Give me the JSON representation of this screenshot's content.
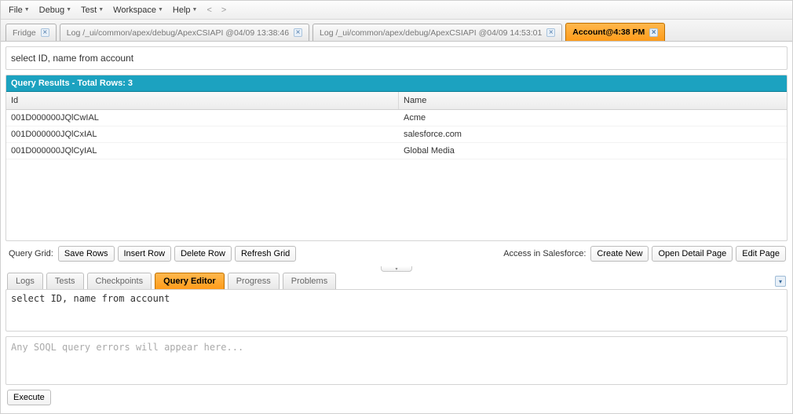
{
  "menubar": {
    "items": [
      "File",
      "Debug",
      "Test",
      "Workspace",
      "Help"
    ]
  },
  "tabs": [
    {
      "label": "Fridge",
      "active": false
    },
    {
      "label": "Log /_ui/common/apex/debug/ApexCSIAPI @04/09 13:38:46",
      "active": false
    },
    {
      "label": "Log /_ui/common/apex/debug/ApexCSIAPI @04/09 14:53:01",
      "active": false
    },
    {
      "label": "Account@4:38 PM",
      "active": true
    }
  ],
  "query_text": "select ID, name from account",
  "results_header": "Query Results - Total Rows: 3",
  "columns": {
    "id": "Id",
    "name": "Name"
  },
  "rows": [
    {
      "id": "001D000000JQlCwIAL",
      "name": "Acme"
    },
    {
      "id": "001D000000JQlCxIAL",
      "name": "salesforce.com"
    },
    {
      "id": "001D000000JQlCyIAL",
      "name": "Global Media"
    }
  ],
  "query_grid_label": "Query Grid:",
  "buttons": {
    "save_rows": "Save Rows",
    "insert_row": "Insert Row",
    "delete_row": "Delete Row",
    "refresh_grid": "Refresh Grid",
    "create_new": "Create New",
    "open_detail_page": "Open Detail Page",
    "edit_page": "Edit Page",
    "execute": "Execute"
  },
  "access_label": "Access in Salesforce:",
  "lower_tabs": [
    {
      "label": "Logs",
      "active": false
    },
    {
      "label": "Tests",
      "active": false
    },
    {
      "label": "Checkpoints",
      "active": false
    },
    {
      "label": "Query Editor",
      "active": true
    },
    {
      "label": "Progress",
      "active": false
    },
    {
      "label": "Problems",
      "active": false
    }
  ],
  "editor_text": "select ID, name from account",
  "error_placeholder": "Any SOQL query errors will appear here..."
}
